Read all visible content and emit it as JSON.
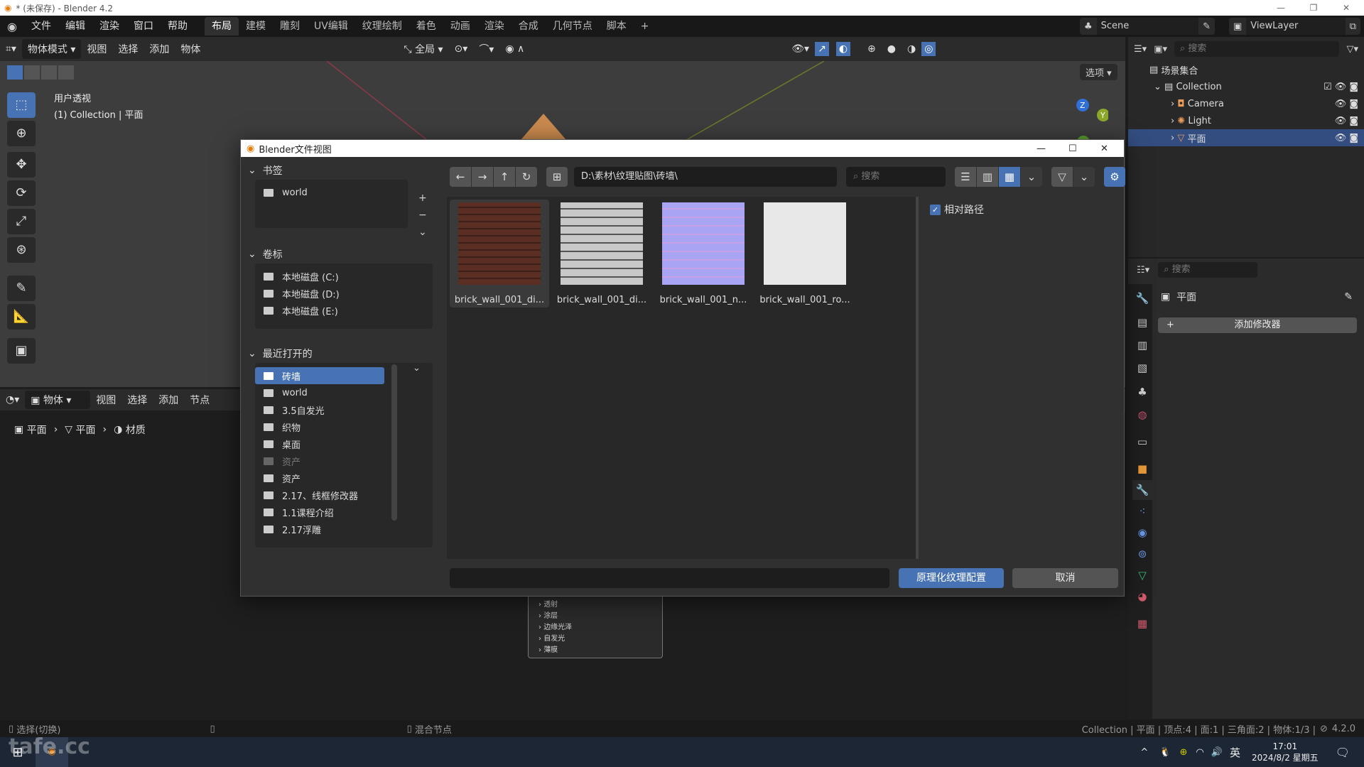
{
  "window": {
    "title": "* (未保存) - Blender 4.2"
  },
  "menu": [
    "文件",
    "编辑",
    "渲染",
    "窗口",
    "帮助"
  ],
  "workspaces": [
    "布局",
    "建模",
    "雕刻",
    "UV编辑",
    "纹理绘制",
    "着色",
    "动画",
    "渲染",
    "合成",
    "几何节点",
    "脚本",
    "+"
  ],
  "active_workspace": "布局",
  "scene": {
    "name": "Scene",
    "view_layer": "ViewLayer"
  },
  "viewport": {
    "mode": "物体模式",
    "menus": [
      "视图",
      "选择",
      "添加",
      "物体"
    ],
    "transform": "全局",
    "overlay_title": "用户透视",
    "overlay_sub": "(1) Collection | 平面",
    "options": "选项"
  },
  "node_editor": {
    "type": "物体",
    "menus": [
      "视图",
      "选择",
      "添加",
      "节点"
    ],
    "breadcrumb": [
      "平面",
      "平面",
      "材质"
    ]
  },
  "outliner": {
    "search_placeholder": "搜索",
    "root": "场景集合",
    "collection": "Collection",
    "items": [
      "Camera",
      "Light",
      "平面"
    ],
    "selected": "平面"
  },
  "properties": {
    "search_placeholder": "搜索",
    "object": "平面",
    "add_modifier": "添加修改器"
  },
  "popup_menu": [
    "透射",
    "涂层",
    "边缘光泽",
    "自发光",
    "薄膜"
  ],
  "dialog": {
    "title": "Blender文件视图",
    "path": "D:\\素材\\纹理贴图\\砖墙\\",
    "search_placeholder": "搜索",
    "bookmarks_label": "书签",
    "bookmarks": [
      "world"
    ],
    "volumes_label": "卷标",
    "volumes": [
      "本地磁盘 (C:)",
      "本地磁盘 (D:)",
      "本地磁盘 (E:)"
    ],
    "recent_label": "最近打开的",
    "recent": [
      "砖墙",
      "world",
      "3.5自发光",
      "织物",
      "桌面",
      "资产",
      "资产",
      "2.17、线框修改器",
      "1.1课程介绍",
      "2.17浮雕"
    ],
    "recent_selected": "砖墙",
    "files": [
      {
        "name": "brick_wall_001_di...",
        "color": "#6b3a2a"
      },
      {
        "name": "brick_wall_001_di...",
        "color": "#b0b0b0"
      },
      {
        "name": "brick_wall_001_n...",
        "color": "#a9a2f2"
      },
      {
        "name": "brick_wall_001_ro...",
        "color": "#e8e8e8"
      }
    ],
    "relative_path_label": "相对路径",
    "relative_path_checked": true,
    "filename_value": "",
    "confirm_label": "原理化纹理配置",
    "cancel_label": "取消"
  },
  "status": {
    "left": "选择(切换)",
    "middle": "混合节点",
    "right": "Collection | 平面 | 顶点:4 | 面:1 | 三角面:2 | 物体:1/3 |",
    "version": "4.2.0"
  },
  "taskbar": {
    "time": "17:01",
    "date": "2024/8/2 星期五",
    "ime": "英"
  },
  "watermark": "tafe.cc",
  "colors": {
    "accent": "#4772b3",
    "header": "#2b2b2b",
    "panel": "#303030"
  }
}
